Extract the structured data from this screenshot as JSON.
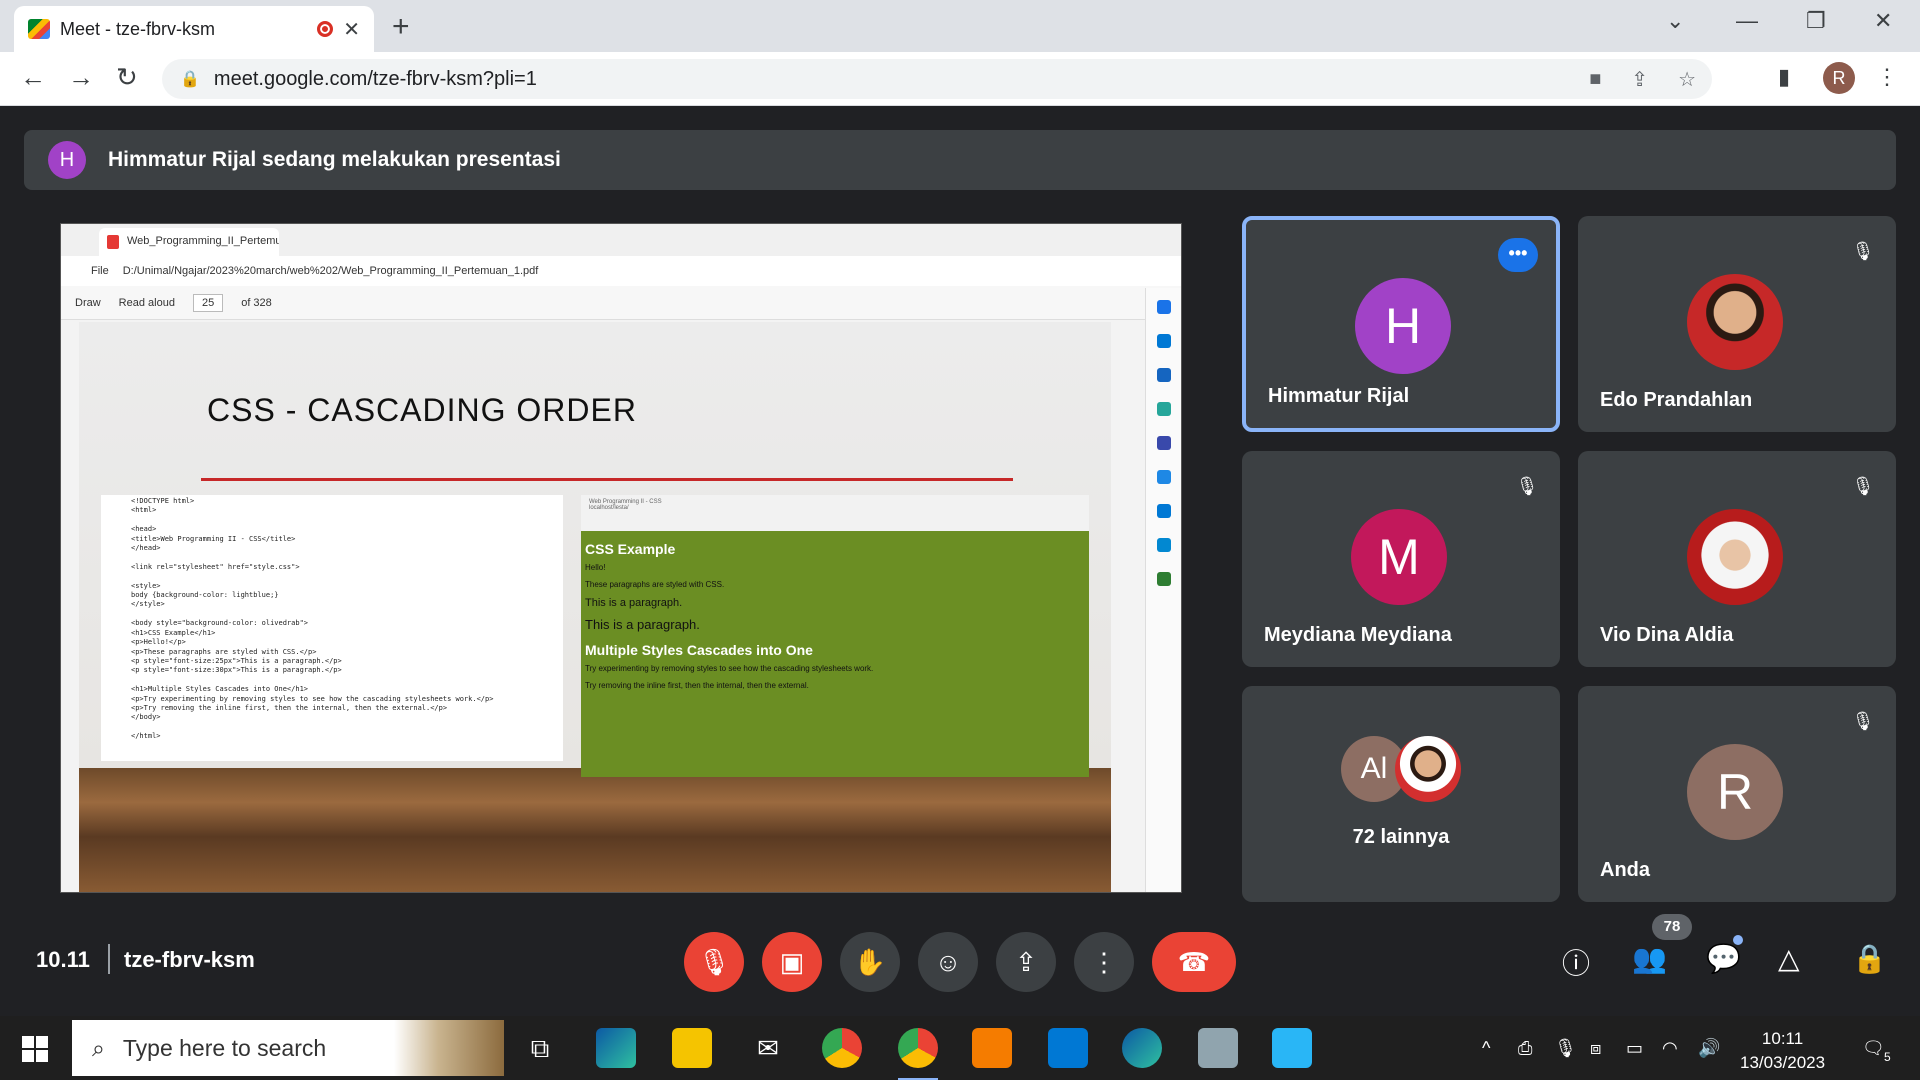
{
  "browser": {
    "tab_title": "Meet - tze-fbrv-ksm",
    "close_symbol": "✕",
    "new_tab_symbol": "+",
    "url": "meet.google.com/tze-fbrv-ksm?pli=1",
    "profile_initial": "R",
    "icons": [
      "back-icon",
      "forward-icon",
      "reload-icon",
      "lock-icon",
      "camera-off-icon",
      "share-icon",
      "star-icon",
      "side-panel-icon",
      "menu-icon"
    ]
  },
  "banner": {
    "avatar_initial": "H",
    "text": "Himmatur Rijal sedang melakukan presentasi",
    "avatar_color": "#a142c7"
  },
  "presentation": {
    "tab_title": "Web_Programming_II_Pertemuan",
    "file_label": "File",
    "path": "D:/Unimal/Ngajar/2023%20march/web%202/Web_Programming_II_Pertemuan_1.pdf",
    "toolbar": {
      "draw": "Draw",
      "read_aloud": "Read aloud",
      "page": "25",
      "of_pages": "of 328"
    },
    "slide": {
      "title": "CSS - CASCADING ORDER",
      "code_lines": [
        "<!DOCTYPE html>",
        "<html>",
        "",
        "<head>",
        "<title>Web Programming II - CSS</title>",
        "</head>",
        "",
        "<link rel=\"stylesheet\" href=\"style.css\">",
        "",
        "<style>",
        "body {background-color: lightblue;}",
        "</style>",
        "",
        "<body style=\"background-color: olivedrab\">",
        "<h1>CSS Example</h1>",
        "<p>Hello!</p>",
        "<p>These paragraphs are styled with CSS.</p>",
        "<p style=\"font-size:25px\">This is a paragraph.</p>",
        "<p style=\"font-size:30px\">This is a paragraph.</p>",
        "",
        "<h1>Multiple Styles Cascades into One</h1>",
        "<p>Try experimenting by removing styles to see how the cascading stylesheets work.</p>",
        "<p>Try removing the inline first, then the internal, then the external.</p>",
        "</body>",
        "",
        "</html>"
      ],
      "preview": {
        "tab": "Web Programming II - CSS",
        "url": "localhost/lesta/",
        "h1": "CSS Example",
        "p1": "Hello!",
        "p2": "These paragraphs are styled with CSS.",
        "p3": "This is a paragraph.",
        "p4": "This is a paragraph.",
        "h2": "Multiple Styles Cascades into One",
        "p5": "Try experimenting by removing styles to see how the cascading stylesheets work.",
        "p6": "Try removing the inline first, then the internal, then the external."
      }
    }
  },
  "participants": [
    {
      "name": "Himmatur Rijal",
      "initial": "H",
      "color": "#a142c7",
      "active": true
    },
    {
      "name": "Edo Prandahlan",
      "photo": true
    },
    {
      "name": "Meydiana Meydiana",
      "initial": "M",
      "color": "#c2185b"
    },
    {
      "name": "Vio Dina Aldia",
      "photo": true
    },
    {
      "others_label": "72 lainnya",
      "stack_initial": "Al"
    },
    {
      "name": "Anda",
      "initial": "R",
      "color": "#8d6e63"
    }
  ],
  "more_symbol": "•••",
  "mute_symbol": "🎙",
  "meeting": {
    "time": "10.11",
    "code": "tze-fbrv-ksm",
    "participant_count": "78"
  },
  "controls": [
    "mic-off-icon",
    "camera-off-icon",
    "raise-hand-icon",
    "emoji-icon",
    "present-icon",
    "more-icon",
    "hang-up-icon"
  ],
  "right_controls": [
    "info-icon",
    "people-icon",
    "chat-icon",
    "activities-icon",
    "host-controls-icon"
  ],
  "taskbar": {
    "search_placeholder": "Type here to search",
    "time": "10:11",
    "date": "13/03/2023",
    "notification_count": "5"
  }
}
